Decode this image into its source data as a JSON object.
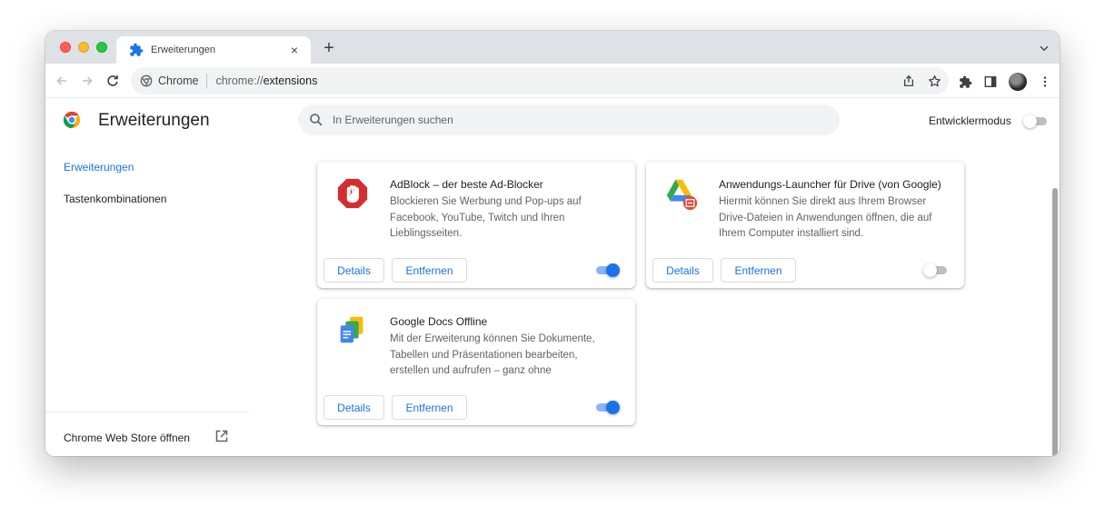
{
  "browser": {
    "tab": {
      "title": "Erweiterungen",
      "close": "×"
    },
    "new_tab": "+",
    "omnibox": {
      "site": "Chrome",
      "url_prefix": "chrome://",
      "url_host": "extensions"
    }
  },
  "header": {
    "title": "Erweiterungen",
    "search_placeholder": "In Erweiterungen suchen",
    "devmode_label": "Entwicklermodus",
    "devmode_on": false
  },
  "sidebar": {
    "items": [
      {
        "label": "Erweiterungen",
        "active": true
      },
      {
        "label": "Tastenkombinationen",
        "active": false
      }
    ],
    "webstore_label": "Chrome Web Store öffnen"
  },
  "extensions": [
    {
      "name": "AdBlock – der beste Ad-Blocker",
      "description": "Blockieren Sie Werbung und Pop-ups auf Facebook, YouTube, Twitch und Ihren Lieblingsseiten.",
      "details_label": "Details",
      "remove_label": "Entfernen",
      "enabled": true,
      "icon": "adblock-icon"
    },
    {
      "name": "Anwendungs-Launcher für Drive (von Google)",
      "description": "Hiermit können Sie direkt aus Ihrem Browser Drive-Dateien in Anwendungen öffnen, die auf Ihrem Computer installiert sind.",
      "details_label": "Details",
      "remove_label": "Entfernen",
      "enabled": false,
      "icon": "drive-launcher-icon"
    },
    {
      "name": "Google Docs Offline",
      "description": "Mit der Erweiterung können Sie Dokumente, Tabellen und Präsentationen bearbeiten, erstellen und aufrufen – ganz ohne Internetverbindung.",
      "details_label": "Details",
      "remove_label": "Entfernen",
      "enabled": true,
      "icon": "docs-offline-icon"
    }
  ],
  "colors": {
    "accent": "#1a73e8",
    "tabstrip": "#dee1e6",
    "omnibox": "#f1f3f4",
    "adblock_red": "#d32f2f"
  }
}
